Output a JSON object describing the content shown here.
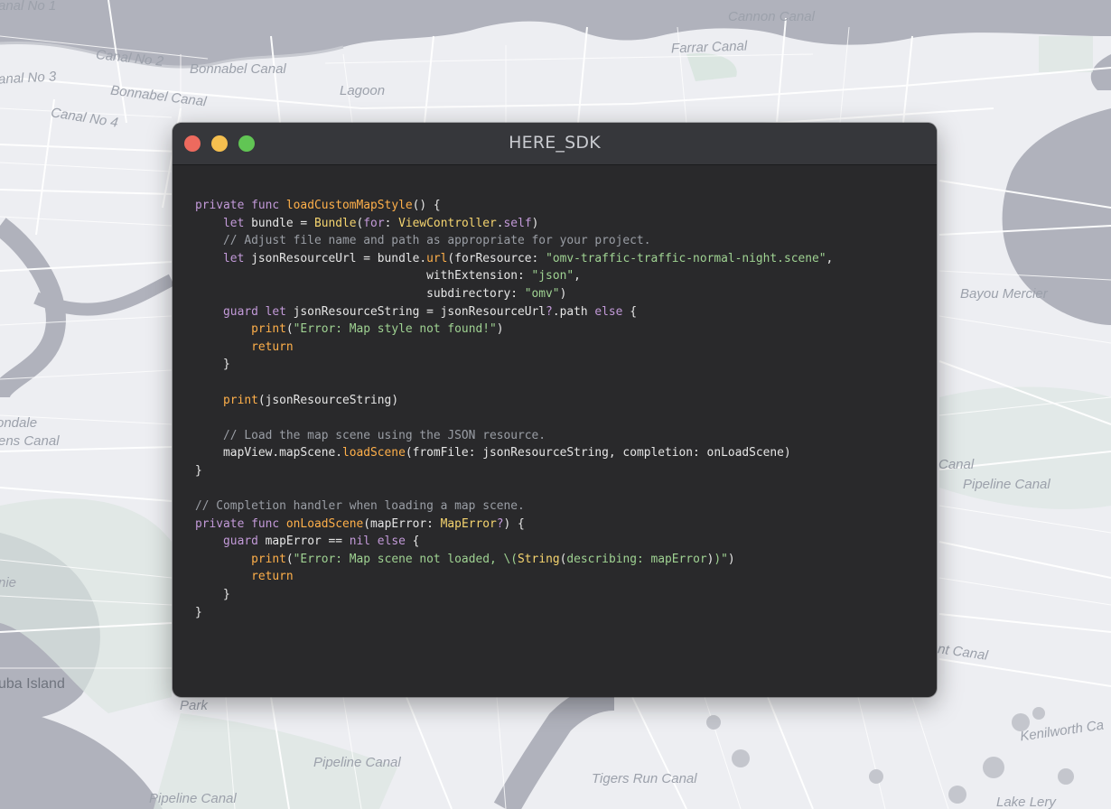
{
  "window": {
    "title": "HERE_SDK",
    "controls": {
      "close_color": "#ed6a5e",
      "minimize_color": "#f5bf4f",
      "zoom_color": "#61c554"
    }
  },
  "map": {
    "labels": [
      {
        "text": "anal No 1",
        "kind": "water"
      },
      {
        "text": "Cannon Canal",
        "kind": "water"
      },
      {
        "text": "Canal No 2",
        "kind": "water"
      },
      {
        "text": "Bonnabel Canal",
        "kind": "water"
      },
      {
        "text": "Farrar Canal",
        "kind": "water"
      },
      {
        "text": "anal No 3",
        "kind": "water"
      },
      {
        "text": "Bonnabel Canal",
        "kind": "water"
      },
      {
        "text": "Lagoon",
        "kind": "water"
      },
      {
        "text": "Canal No 4",
        "kind": "water"
      },
      {
        "text": "Bayou Mercier",
        "kind": "water"
      },
      {
        "text": "ondale",
        "kind": "water"
      },
      {
        "text": "ens Canal",
        "kind": "water"
      },
      {
        "text": "Canal",
        "kind": "water"
      },
      {
        "text": "Pipeline Canal",
        "kind": "water"
      },
      {
        "text": "nie",
        "kind": "water"
      },
      {
        "text": "nt Canal",
        "kind": "water"
      },
      {
        "text": "uba Island",
        "kind": "place"
      },
      {
        "text": "Park",
        "kind": "water"
      },
      {
        "text": "Pipeline Canal",
        "kind": "water"
      },
      {
        "text": "Pipeline Canal",
        "kind": "water"
      },
      {
        "text": "Tigers Run Canal",
        "kind": "water"
      },
      {
        "text": "Kenilworth Ca",
        "kind": "water"
      },
      {
        "text": "Lake Lery",
        "kind": "water"
      }
    ]
  },
  "code": {
    "language": "swift",
    "lines": [
      [
        [
          "kw",
          "private func "
        ],
        [
          "fn",
          "loadCustomMapStyle"
        ],
        [
          "pl",
          "() {"
        ]
      ],
      [
        [
          "pl",
          "    "
        ],
        [
          "kw",
          "let "
        ],
        [
          "pl",
          "bundle = "
        ],
        [
          "ty",
          "Bundle"
        ],
        [
          "pl",
          "("
        ],
        [
          "kw",
          "for"
        ],
        [
          "pl",
          ": "
        ],
        [
          "ty",
          "ViewController"
        ],
        [
          "pl",
          "."
        ],
        [
          "kw",
          "self"
        ],
        [
          "pl",
          ")"
        ]
      ],
      [
        [
          "pl",
          "    "
        ],
        [
          "cm",
          "// Adjust file name and path as appropriate for your project."
        ]
      ],
      [
        [
          "pl",
          "    "
        ],
        [
          "kw",
          "let "
        ],
        [
          "pl",
          "jsonResourceUrl = bundle."
        ],
        [
          "fn",
          "url"
        ],
        [
          "pl",
          "(forResource: "
        ],
        [
          "str",
          "\"omv-traffic-traffic-normal-night.scene\""
        ],
        [
          "pl",
          ","
        ]
      ],
      [
        [
          "pl",
          "                                 withExtension: "
        ],
        [
          "str",
          "\"json\""
        ],
        [
          "pl",
          ","
        ]
      ],
      [
        [
          "pl",
          "                                 subdirectory: "
        ],
        [
          "str",
          "\"omv\""
        ],
        [
          "pl",
          ")"
        ]
      ],
      [
        [
          "pl",
          "    "
        ],
        [
          "kw",
          "guard let "
        ],
        [
          "pl",
          "jsonResourceString = jsonResourceUrl"
        ],
        [
          "kw",
          "?"
        ],
        [
          "pl",
          ".path "
        ],
        [
          "kw",
          "else"
        ],
        [
          "pl",
          " {"
        ]
      ],
      [
        [
          "pl",
          "        "
        ],
        [
          "fn",
          "print"
        ],
        [
          "pl",
          "("
        ],
        [
          "str",
          "\"Error: Map style not found!\""
        ],
        [
          "pl",
          ")"
        ]
      ],
      [
        [
          "pl",
          "        "
        ],
        [
          "fn",
          "return"
        ]
      ],
      [
        [
          "pl",
          "    }"
        ]
      ],
      [],
      [
        [
          "pl",
          "    "
        ],
        [
          "fn",
          "print"
        ],
        [
          "pl",
          "(jsonResourceString)"
        ]
      ],
      [],
      [
        [
          "pl",
          "    "
        ],
        [
          "cm",
          "// Load the map scene using the JSON resource."
        ]
      ],
      [
        [
          "pl",
          "    mapView.mapScene."
        ],
        [
          "fn",
          "loadScene"
        ],
        [
          "pl",
          "(fromFile: jsonResourceString, completion: onLoadScene)"
        ]
      ],
      [
        [
          "pl",
          "}"
        ]
      ],
      [],
      [
        [
          "cm",
          "// Completion handler when loading a map scene."
        ]
      ],
      [
        [
          "kw",
          "private func "
        ],
        [
          "fn",
          "onLoadScene"
        ],
        [
          "pl",
          "(mapError: "
        ],
        [
          "ty",
          "MapError"
        ],
        [
          "kw",
          "?"
        ],
        [
          "pl",
          ") {"
        ]
      ],
      [
        [
          "pl",
          "    "
        ],
        [
          "kw",
          "guard "
        ],
        [
          "pl",
          "mapError == "
        ],
        [
          "kw",
          "nil else"
        ],
        [
          "pl",
          " {"
        ]
      ],
      [
        [
          "pl",
          "        "
        ],
        [
          "fn",
          "print"
        ],
        [
          "pl",
          "("
        ],
        [
          "str",
          "\"Error: Map scene not loaded, \\("
        ],
        [
          "ty",
          "String"
        ],
        [
          "pl",
          "("
        ],
        [
          "str",
          "describing: mapError"
        ],
        [
          "pl",
          ")"
        ],
        [
          "str",
          ")\""
        ],
        [
          "pl",
          ")"
        ]
      ],
      [
        [
          "pl",
          "        "
        ],
        [
          "fn",
          "return"
        ]
      ],
      [
        [
          "pl",
          "    }"
        ]
      ],
      [
        [
          "pl",
          "}"
        ]
      ]
    ]
  }
}
